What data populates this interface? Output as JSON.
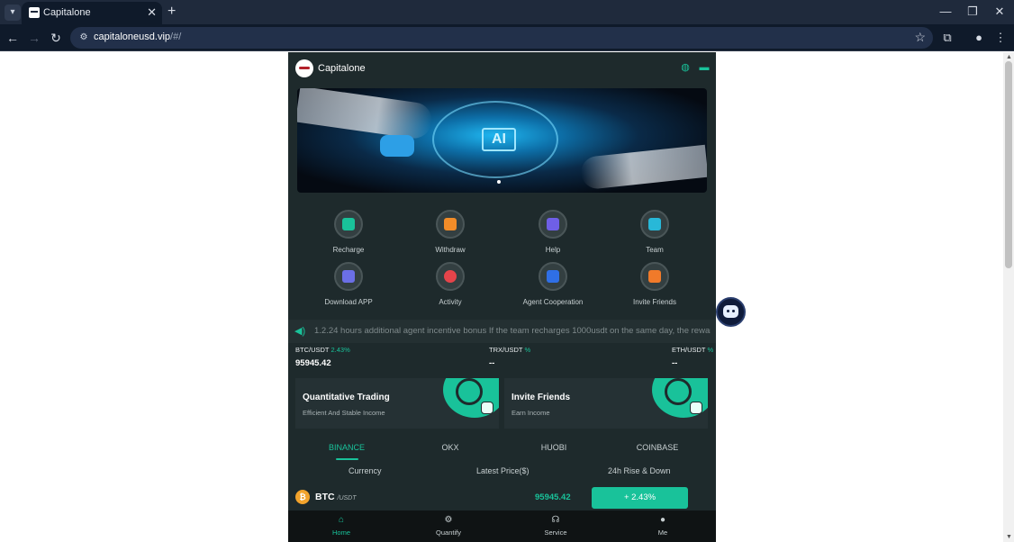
{
  "browser": {
    "tab_title": "Capitalone",
    "url_host": "capitaloneusd.vip",
    "url_path": "/#/"
  },
  "app": {
    "brand": "Capitalone",
    "banner_text": "AI",
    "menu": [
      {
        "label": "Recharge",
        "icon": "wallet-icon",
        "color": "#19c29a"
      },
      {
        "label": "Withdraw",
        "icon": "coin-hand-icon",
        "color": "#f28c28"
      },
      {
        "label": "Help",
        "icon": "book-icon",
        "color": "#6f5fe6"
      },
      {
        "label": "Team",
        "icon": "team-icon",
        "color": "#28b8d8"
      },
      {
        "label": "Download APP",
        "icon": "folder-download-icon",
        "color": "#6b6fe6"
      },
      {
        "label": "Activity",
        "icon": "activity-icon",
        "color": "#e6444a"
      },
      {
        "label": "Agent Cooperation",
        "icon": "agent-icon",
        "color": "#2f6fe6"
      },
      {
        "label": "Invite Friends",
        "icon": "gift-icon",
        "color": "#f07a2a"
      }
    ],
    "notice": "1.2.24 hours additional agent incentive bonus If the team recharges 1000usdt on the same day, the rewar",
    "tickers": [
      {
        "pair": "BTC/USDT",
        "pct": "2.43%",
        "price": "95945.42"
      },
      {
        "pair": "TRX/USDT",
        "pct": "%",
        "price": "--"
      },
      {
        "pair": "ETH/USDT",
        "pct": "%",
        "price": "--"
      }
    ],
    "cards": [
      {
        "title": "Quantitative Trading",
        "subtitle": "Efficient And Stable Income"
      },
      {
        "title": "Invite Friends",
        "subtitle": "Earn Income"
      }
    ],
    "exchanges": [
      "BINANCE",
      "OKX",
      "HUOBI",
      "COINBASE"
    ],
    "active_exchange": "BINANCE",
    "columns": [
      "Currency",
      "Latest Price($)",
      "24h Rise & Down"
    ],
    "rows": [
      {
        "symbol": "BTC",
        "quote": "/USDT",
        "price": "95945.42",
        "change": "+ 2.43%"
      }
    ],
    "nav": [
      {
        "label": "Home",
        "icon": "home-icon"
      },
      {
        "label": "Quantify",
        "icon": "gear-icon"
      },
      {
        "label": "Service",
        "icon": "headset-icon"
      },
      {
        "label": "Me",
        "icon": "user-icon"
      }
    ],
    "accent_color": "#19c29a"
  }
}
